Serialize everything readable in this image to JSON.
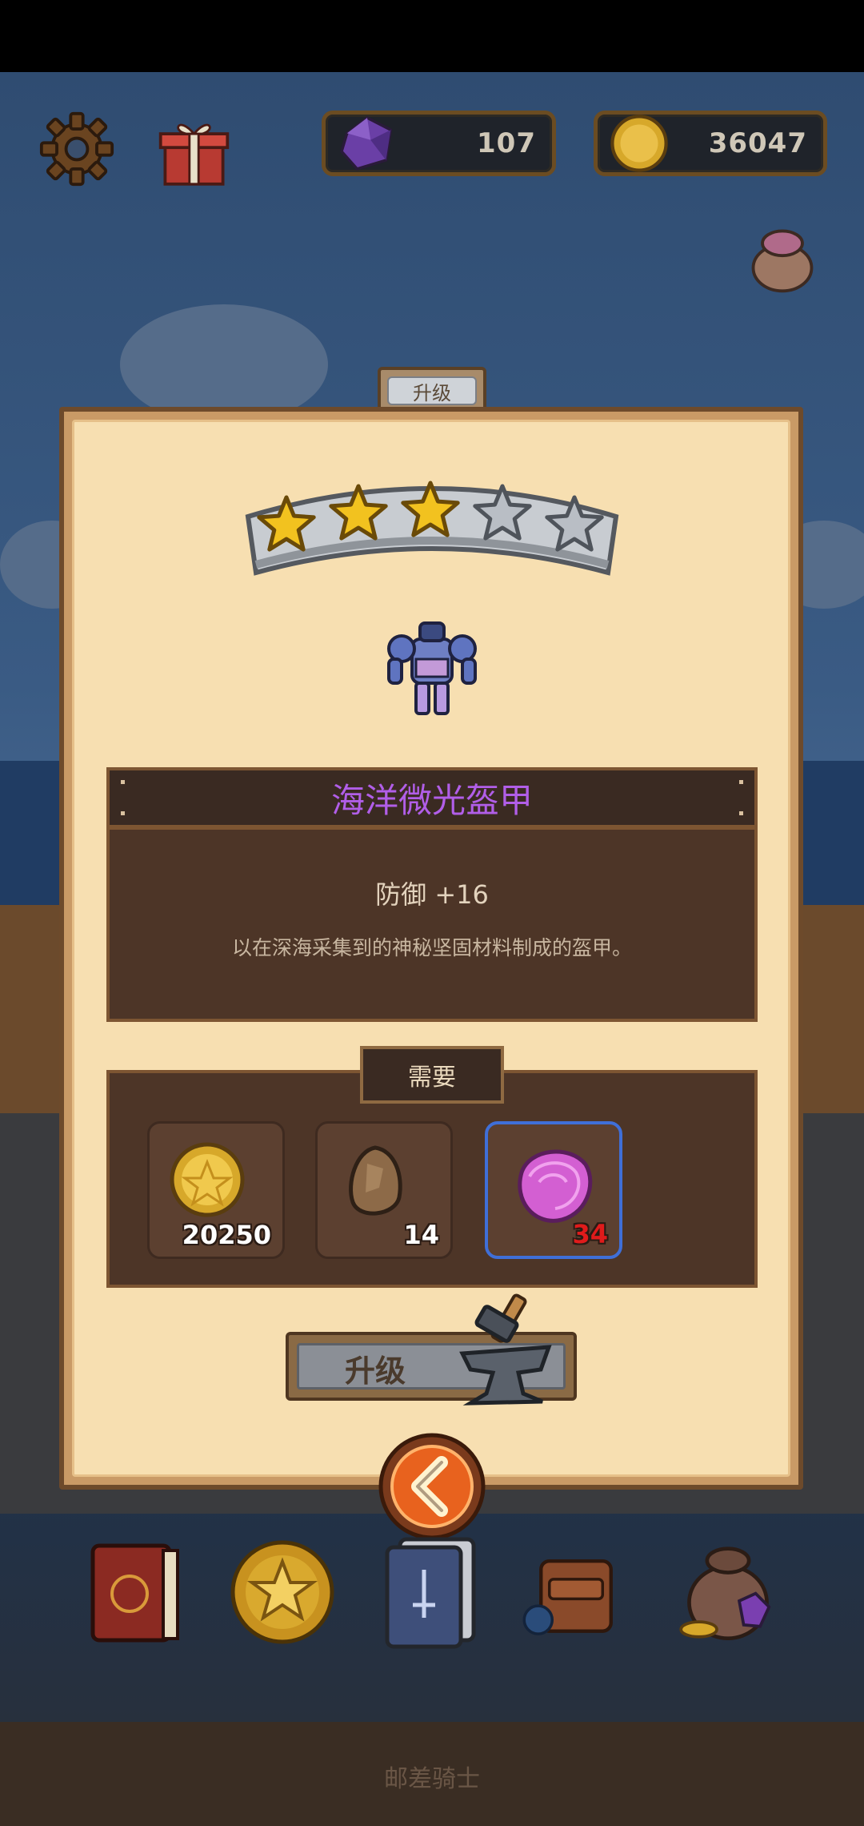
{
  "hud": {
    "gem_count": "107",
    "coin_count": "36047"
  },
  "panel": {
    "tab_label": "升级",
    "stars_total": 5,
    "stars_filled": 3,
    "item_name": "海洋微光盔甲",
    "stat_text": "防御 +16",
    "description": "以在深海采集到的神秘坚固材料制成的盔甲。",
    "requirements_label": "需要",
    "requirements": [
      {
        "icon": "gold-coin-icon",
        "count": "20250",
        "sufficient": true
      },
      {
        "icon": "rough-stone-icon",
        "count": "14",
        "sufficient": true
      },
      {
        "icon": "pink-shell-ore-icon",
        "count": "34",
        "sufficient": false
      }
    ],
    "upgrade_button_label": "升级"
  },
  "bottom_nav": [
    {
      "icon": "red-book-icon"
    },
    {
      "icon": "star-medal-icon"
    },
    {
      "icon": "card-deck-icon"
    },
    {
      "icon": "backpack-icon"
    },
    {
      "icon": "treasure-bag-icon"
    }
  ],
  "footer": {
    "title": "邮差骑士"
  },
  "colors": {
    "item_name": "#b15ee8",
    "insufficient_count": "#e01b1b",
    "highlight_border": "#3f6fd8"
  }
}
